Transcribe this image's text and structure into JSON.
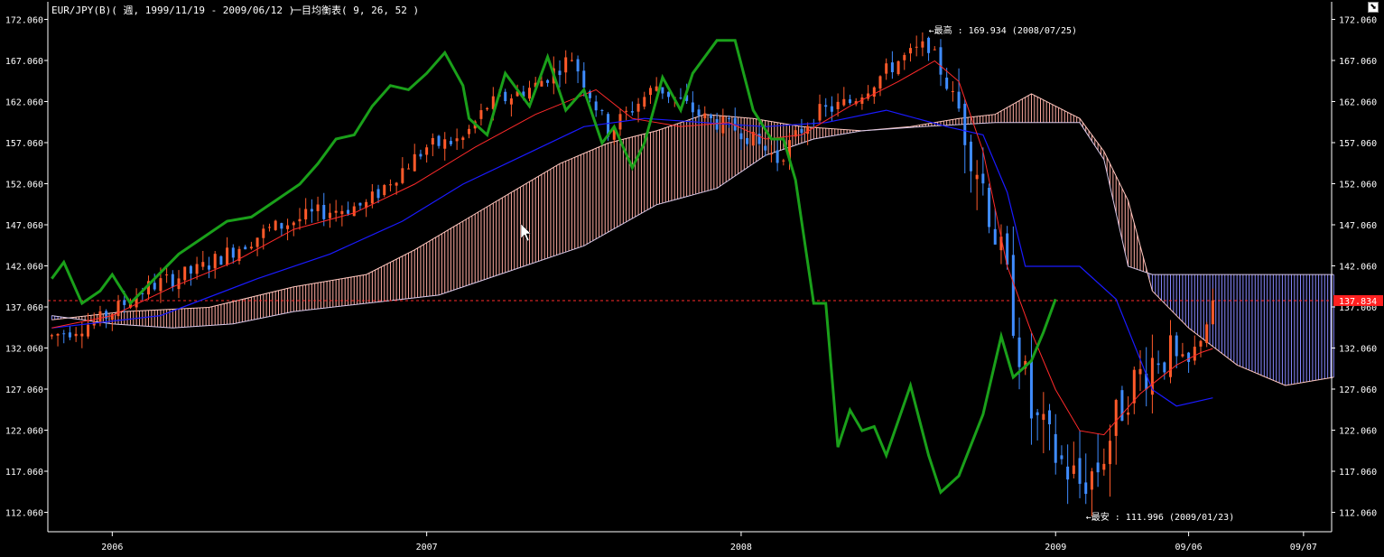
{
  "header": {
    "symbol_label": "EUR/JPY(B)( 週, 1999/11/19 - 2009/06/12 )",
    "indicator_label": "一目均衡表( 9, 26, 52 )"
  },
  "corner_button": {
    "icon": "restore-icon",
    "glyph": "⬊"
  },
  "colors": {
    "background": "#000000",
    "axis": "#ffffff",
    "bull_candle": "#ff5a2a",
    "bear_candle": "#3f8cff",
    "tenkan": "#ff2a2a",
    "kijun": "#1a1aff",
    "chikou": "#1aa01a",
    "cloud_bull": "#ffaaa0",
    "cloud_bear": "#8888ff",
    "last_price_line": "#ff2a2a",
    "last_price_box": "#ff2020"
  },
  "chart_data": {
    "type": "candlestick-ichimoku",
    "y_ticks": [
      "172.060",
      "167.060",
      "162.060",
      "157.060",
      "152.060",
      "147.060",
      "142.060",
      "137.060",
      "132.060",
      "127.060",
      "122.060",
      "117.060",
      "112.060"
    ],
    "y_tick_values": [
      172.06,
      167.06,
      162.06,
      157.06,
      152.06,
      147.06,
      142.06,
      137.06,
      132.06,
      127.06,
      122.06,
      117.06,
      112.06
    ],
    "ylim": [
      109.7,
      174.2
    ],
    "x_ticks": [
      {
        "label": "2006",
        "week": 10
      },
      {
        "label": "2007",
        "week": 62
      },
      {
        "label": "2008",
        "week": 114
      },
      {
        "label": "2009",
        "week": 166
      },
      {
        "label": "09/06",
        "week": 188
      },
      {
        "label": "09/07",
        "week": 207
      }
    ],
    "weeks_total": 212,
    "last_price": {
      "label": "137.834",
      "value": 137.834
    },
    "annotations": [
      {
        "text": "←最高 : 169.934 (2008/07/25)",
        "week": 145,
        "value": 169.934
      },
      {
        "text": "←最安 : 111.996 (2009/01/23)",
        "week": 171,
        "value": 111.996
      }
    ],
    "close_path": [
      [
        0,
        133.5
      ],
      [
        8,
        135.5
      ],
      [
        16,
        139.5
      ],
      [
        24,
        141.5
      ],
      [
        36,
        146.5
      ],
      [
        44,
        148.5
      ],
      [
        52,
        149.5
      ],
      [
        56,
        152.5
      ],
      [
        62,
        156.5
      ],
      [
        68,
        157.5
      ],
      [
        72,
        161.5
      ],
      [
        80,
        164.0
      ],
      [
        86,
        167.5
      ],
      [
        92,
        158.5
      ],
      [
        100,
        164.0
      ],
      [
        108,
        160.0
      ],
      [
        114,
        158.5
      ],
      [
        120,
        155.0
      ],
      [
        126,
        160.5
      ],
      [
        132,
        162.0
      ],
      [
        140,
        167.0
      ],
      [
        145,
        169.0
      ],
      [
        150,
        161.0
      ],
      [
        154,
        152.0
      ],
      [
        158,
        140.0
      ],
      [
        162,
        124.0
      ],
      [
        166,
        119.0
      ],
      [
        170,
        115.5
      ],
      [
        173,
        117.5
      ],
      [
        178,
        127.0
      ],
      [
        183,
        131.5
      ],
      [
        188,
        130.0
      ],
      [
        192,
        137.0
      ]
    ],
    "chikou": [
      [
        0,
        140.5
      ],
      [
        2,
        142.5
      ],
      [
        5,
        137.5
      ],
      [
        8,
        139.0
      ],
      [
        10,
        141.0
      ],
      [
        13,
        137.5
      ],
      [
        17,
        140.5
      ],
      [
        21,
        143.5
      ],
      [
        25,
        145.5
      ],
      [
        29,
        147.5
      ],
      [
        33,
        148.0
      ],
      [
        37,
        150.0
      ],
      [
        41,
        152.0
      ],
      [
        44,
        154.5
      ],
      [
        47,
        157.5
      ],
      [
        50,
        158.0
      ],
      [
        53,
        161.5
      ],
      [
        56,
        164.0
      ],
      [
        59,
        163.5
      ],
      [
        62,
        165.5
      ],
      [
        65,
        168.0
      ],
      [
        68,
        164.0
      ],
      [
        69,
        160.0
      ],
      [
        72,
        158.0
      ],
      [
        75,
        165.5
      ],
      [
        79,
        161.5
      ],
      [
        82,
        167.5
      ],
      [
        85,
        161.0
      ],
      [
        88,
        163.5
      ],
      [
        91,
        157.0
      ],
      [
        93,
        159.0
      ],
      [
        96,
        154.0
      ],
      [
        98,
        157.0
      ],
      [
        101,
        165.0
      ],
      [
        104,
        161.0
      ],
      [
        106,
        165.5
      ],
      [
        110,
        169.5
      ],
      [
        113,
        169.5
      ],
      [
        116,
        161.0
      ],
      [
        119,
        157.5
      ],
      [
        121,
        157.5
      ],
      [
        123,
        152.5
      ],
      [
        126,
        137.5
      ],
      [
        128,
        137.5
      ],
      [
        130,
        120.0
      ],
      [
        132,
        124.5
      ],
      [
        134,
        122.0
      ],
      [
        136,
        122.5
      ],
      [
        138,
        119.0
      ],
      [
        142,
        127.5
      ],
      [
        145,
        119.0
      ],
      [
        147,
        114.5
      ],
      [
        150,
        116.5
      ],
      [
        154,
        124.0
      ],
      [
        157,
        133.5
      ],
      [
        159,
        128.5
      ],
      [
        162,
        130.5
      ],
      [
        164,
        134.0
      ],
      [
        166,
        138.0
      ]
    ],
    "tenkan": [
      [
        0,
        134.5
      ],
      [
        10,
        136.0
      ],
      [
        20,
        139.5
      ],
      [
        30,
        142.5
      ],
      [
        40,
        146.5
      ],
      [
        50,
        148.5
      ],
      [
        60,
        152.0
      ],
      [
        70,
        156.5
      ],
      [
        80,
        160.5
      ],
      [
        90,
        163.5
      ],
      [
        96,
        160.0
      ],
      [
        104,
        159.0
      ],
      [
        112,
        159.5
      ],
      [
        118,
        157.5
      ],
      [
        124,
        158.0
      ],
      [
        132,
        161.5
      ],
      [
        140,
        164.5
      ],
      [
        146,
        167.0
      ],
      [
        150,
        164.5
      ],
      [
        154,
        156.0
      ],
      [
        158,
        142.0
      ],
      [
        162,
        134.0
      ],
      [
        166,
        127.0
      ],
      [
        170,
        122.0
      ],
      [
        174,
        121.5
      ],
      [
        180,
        126.5
      ],
      [
        186,
        130.0
      ],
      [
        190,
        131.5
      ],
      [
        192,
        132.0
      ]
    ],
    "kijun": [
      [
        0,
        134.5
      ],
      [
        18,
        136.0
      ],
      [
        34,
        140.5
      ],
      [
        46,
        143.5
      ],
      [
        58,
        147.5
      ],
      [
        68,
        152.0
      ],
      [
        78,
        155.5
      ],
      [
        88,
        159.0
      ],
      [
        98,
        160.0
      ],
      [
        108,
        159.5
      ],
      [
        118,
        159.0
      ],
      [
        128,
        159.5
      ],
      [
        138,
        161.0
      ],
      [
        148,
        159.0
      ],
      [
        154,
        158.0
      ],
      [
        158,
        151.0
      ],
      [
        161,
        142.0
      ],
      [
        170,
        142.0
      ],
      [
        176,
        138.0
      ],
      [
        182,
        127.0
      ],
      [
        186,
        125.0
      ],
      [
        192,
        126.0
      ]
    ],
    "span_a": [
      [
        0,
        135.5
      ],
      [
        12,
        136.5
      ],
      [
        26,
        137.0
      ],
      [
        40,
        139.5
      ],
      [
        52,
        141.0
      ],
      [
        60,
        144.0
      ],
      [
        68,
        147.5
      ],
      [
        76,
        151.0
      ],
      [
        84,
        154.5
      ],
      [
        92,
        157.0
      ],
      [
        100,
        158.5
      ],
      [
        108,
        160.5
      ],
      [
        116,
        160.0
      ],
      [
        124,
        159.0
      ],
      [
        134,
        158.5
      ],
      [
        142,
        159.0
      ],
      [
        150,
        160.0
      ],
      [
        156,
        160.5
      ],
      [
        162,
        163.0
      ],
      [
        166,
        161.5
      ],
      [
        170,
        160.0
      ],
      [
        174,
        156.0
      ],
      [
        178,
        150.0
      ],
      [
        182,
        139.0
      ],
      [
        188,
        134.5
      ],
      [
        196,
        130.0
      ],
      [
        204,
        127.5
      ],
      [
        212,
        128.5
      ]
    ],
    "span_b": [
      [
        0,
        136.0
      ],
      [
        10,
        135.0
      ],
      [
        20,
        134.5
      ],
      [
        30,
        135.0
      ],
      [
        40,
        136.5
      ],
      [
        52,
        137.5
      ],
      [
        64,
        138.5
      ],
      [
        76,
        141.5
      ],
      [
        88,
        144.5
      ],
      [
        100,
        149.5
      ],
      [
        110,
        151.5
      ],
      [
        118,
        155.5
      ],
      [
        126,
        157.5
      ],
      [
        134,
        158.5
      ],
      [
        144,
        159.0
      ],
      [
        156,
        159.5
      ],
      [
        166,
        159.5
      ],
      [
        170,
        159.5
      ],
      [
        174,
        155.0
      ],
      [
        178,
        142.0
      ],
      [
        182,
        141.0
      ],
      [
        200,
        141.0
      ],
      [
        212,
        141.0
      ]
    ]
  }
}
